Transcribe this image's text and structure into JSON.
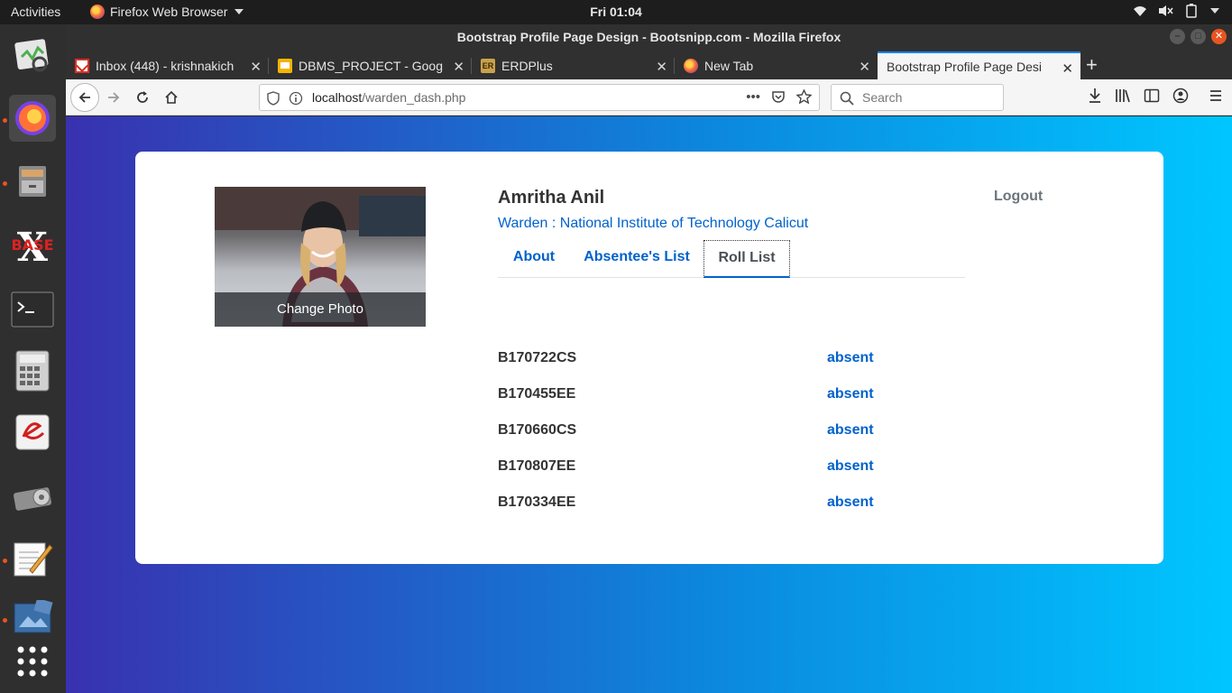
{
  "topbar": {
    "activities": "Activities",
    "app_name": "Firefox Web Browser",
    "clock": "Fri 01:04"
  },
  "window": {
    "title": "Bootstrap Profile Page Design - Bootsnipp.com - Mozilla Firefox"
  },
  "tabs": [
    {
      "label": "Inbox (448) - krishnakich",
      "icon": "gmail-icon"
    },
    {
      "label": "DBMS_PROJECT - Google",
      "icon": "google-slides-icon"
    },
    {
      "label": "ERDPlus",
      "icon": "erdplus-icon"
    },
    {
      "label": "New Tab",
      "icon": "firefox-icon"
    },
    {
      "label": "Bootstrap Profile Page Desi",
      "icon": "none",
      "active": true
    }
  ],
  "navbar": {
    "url_host": "localhost",
    "url_path": "/warden_dash.php",
    "search_placeholder": "Search"
  },
  "profile": {
    "name": "Amritha Anil",
    "role": "Warden : National Institute of Technology Calicut",
    "change_photo": "Change Photo",
    "logout": "Logout",
    "tabs": [
      {
        "label": "About",
        "active": false
      },
      {
        "label": "Absentee's List",
        "active": false
      },
      {
        "label": "Roll List",
        "active": true
      }
    ]
  },
  "roll_list": [
    {
      "id": "B170722CS",
      "status": "absent"
    },
    {
      "id": "B170455EE",
      "status": "absent"
    },
    {
      "id": "B170660CS",
      "status": "absent"
    },
    {
      "id": "B170807EE",
      "status": "absent"
    },
    {
      "id": "B170334EE",
      "status": "absent"
    }
  ],
  "colors": {
    "gradient_start": "#3931af",
    "gradient_end": "#00c6ff",
    "link": "#0062cc",
    "ubuntu_orange": "#e95420"
  }
}
